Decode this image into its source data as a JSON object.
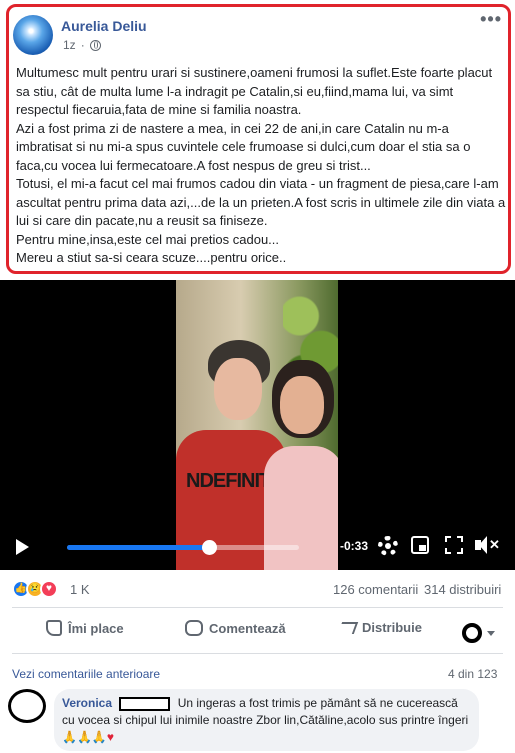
{
  "post": {
    "author": "Aurelia Deliu",
    "time": "1z",
    "more_icon": "more-horizontal-icon",
    "privacy_icon": "globe-icon",
    "paragraphs": [
      "Multumesc mult pentru urari si sustinere,oameni frumosi la suflet.Este foarte placut sa stiu, cât de multa lume l-a indragit pe Catalin,si eu,fiind,mama lui, va simt respectul fiecaruia,fata de mine si familia noastra.",
      "Azi a fost prima zi de nastere a mea, in cei 22 de ani,in care Catalin nu m-a imbratisat si nu mi-a spus cuvintele cele frumoase si dulci,cum doar el stia sa o faca,cu vocea lui fermecatoare.A fost nespus de greu si trist...",
      "Totusi, el mi-a facut cel mai frumos cadou din viata - un fragment de piesa,care l-am ascultat pentru prima data azi,...de la un prieten.A fost scris in ultimele zile din viata a lui si care din pacate,nu a reusit sa finiseze.",
      "Pentru mine,insa,este cel mai pretios cadou...",
      "Mereu a stiut sa-si ceara scuze....pentru orice.."
    ],
    "highlight_color": "#e0232b"
  },
  "video": {
    "time_remaining": "-0:33",
    "progress_fraction": 0.61,
    "shirt_text": "NDEFINIT",
    "controls": {
      "play": "play-icon",
      "settings": "gear-icon",
      "pip": "picture-in-picture-icon",
      "fullscreen": "fullscreen-icon",
      "mute": "mute-icon"
    },
    "accent_color": "#1877f2"
  },
  "stats": {
    "reaction_icons": [
      "like-icon",
      "sad-icon",
      "love-icon"
    ],
    "reaction_count": "1 K",
    "comments": "126 comentarii",
    "shares": "314 distribuiri"
  },
  "actions": {
    "like": "Îmi place",
    "comment": "Comentează",
    "share": "Distribuie"
  },
  "comments": {
    "view_previous": "Vezi comentariile anterioare",
    "position": "4 din 123",
    "items": [
      {
        "author": "Veronica",
        "text": "Un ingeras a fost trimis pe pământ să ne cucerească cu vocea si chipul lui inimile noastre Zbor lin,Cătăline,acolo sus printre îngeri",
        "emoji": "🙏🙏🙏",
        "heart": "♥"
      }
    ]
  }
}
